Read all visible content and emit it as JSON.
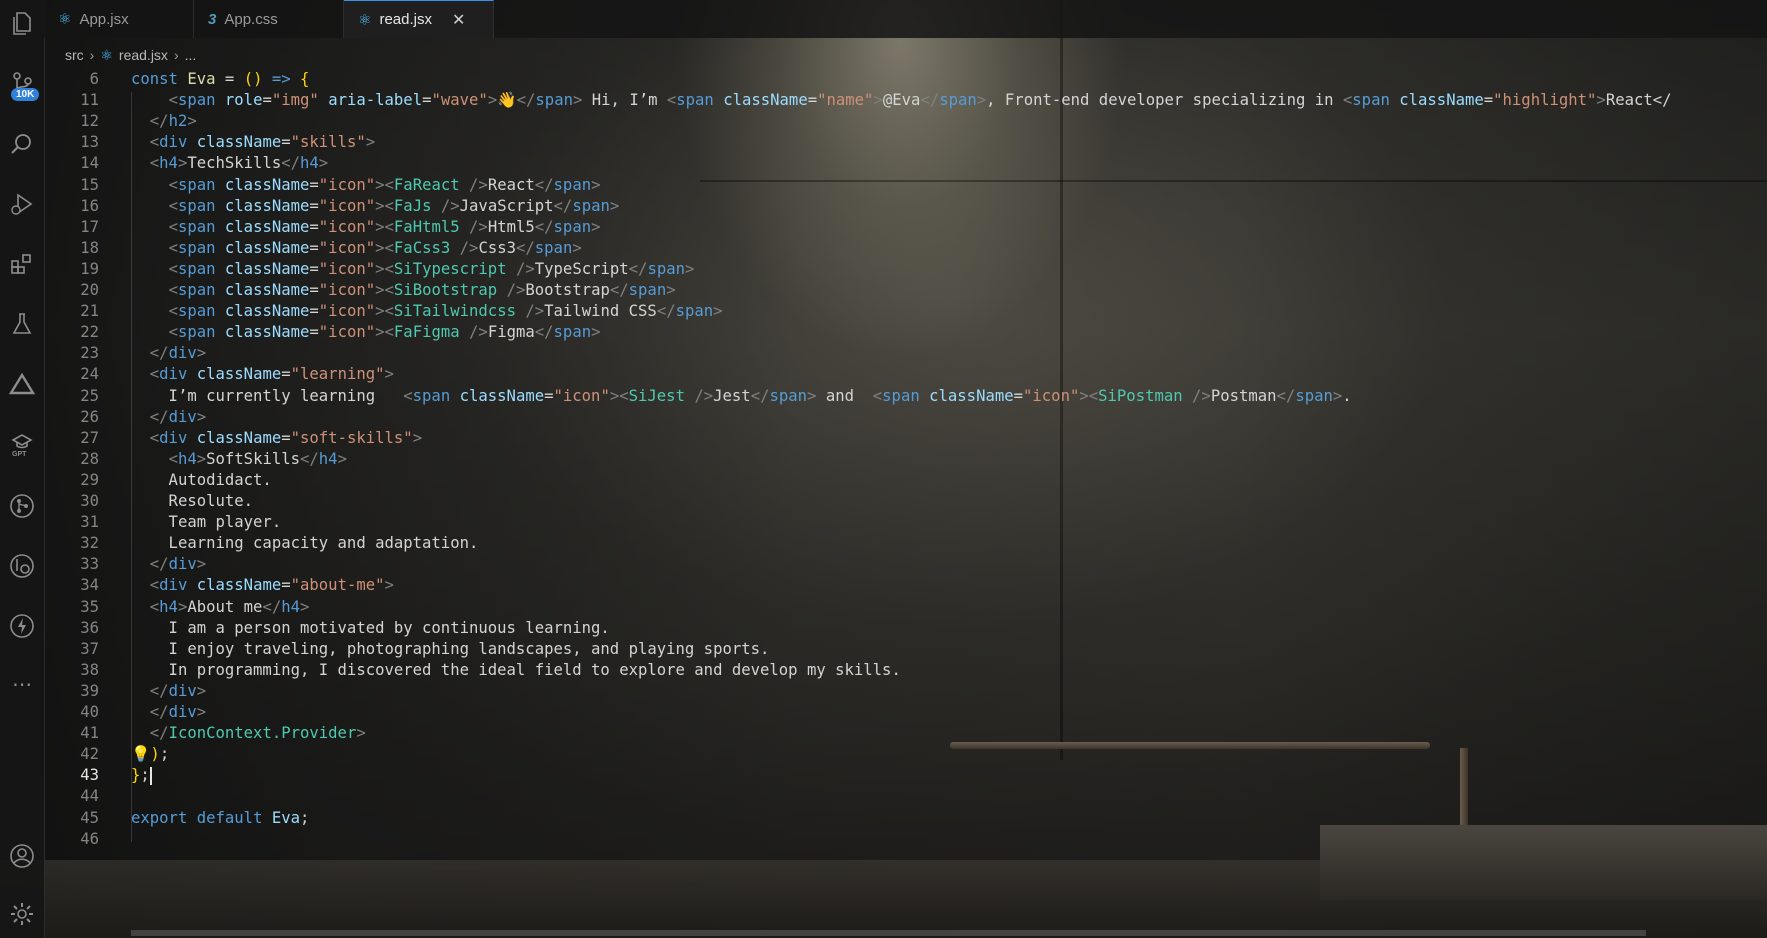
{
  "tabs": [
    {
      "label": "App.jsx",
      "icon": "react-icon",
      "active": false
    },
    {
      "label": "App.css",
      "icon": "css-icon",
      "active": false
    },
    {
      "label": "read.jsx",
      "icon": "react-icon",
      "active": true
    }
  ],
  "close_glyph": "✕",
  "breadcrumb": {
    "folder": "src",
    "file": "read.jsx",
    "more": "..."
  },
  "activity": {
    "items": [
      "explorer-icon",
      "source-control-icon",
      "search-icon",
      "run-debug-icon",
      "extensions-icon",
      "testing-icon",
      "deploy-icon",
      "gpt-icon",
      "git-graph-icon",
      "remote-icon",
      "lightning-icon",
      "more-icon",
      "account-icon",
      "settings-icon"
    ],
    "badge": "10K"
  },
  "editor": {
    "current_line": "43",
    "lines": [
      {
        "n": "6",
        "t": "const Eva = () => {"
      },
      {
        "n": "11",
        "t": "    <span role=\"img\" aria-label=\"wave\">👋</span> Hi, I’m <span className=\"name\">@Eva</span>, Front-end developer specializing in <span className=\"highlight\">React</"
      },
      {
        "n": "12",
        "t": "  </h2>"
      },
      {
        "n": "13",
        "t": "  <div className=\"skills\">"
      },
      {
        "n": "14",
        "t": "  <h4>TechSkills</h4>"
      },
      {
        "n": "15",
        "t": "    <span className=\"icon\"><FaReact />React</span>"
      },
      {
        "n": "16",
        "t": "    <span className=\"icon\"><FaJs />JavaScript</span>"
      },
      {
        "n": "17",
        "t": "    <span className=\"icon\"><FaHtml5 />Html5</span>"
      },
      {
        "n": "18",
        "t": "    <span className=\"icon\"><FaCss3 />Css3</span>"
      },
      {
        "n": "19",
        "t": "    <span className=\"icon\"><SiTypescript />TypeScript</span>"
      },
      {
        "n": "20",
        "t": "    <span className=\"icon\"><SiBootstrap />Bootstrap</span>"
      },
      {
        "n": "21",
        "t": "    <span className=\"icon\"><SiTailwindcss />Tailwind CSS</span>"
      },
      {
        "n": "22",
        "t": "    <span className=\"icon\"><FaFigma />Figma</span>"
      },
      {
        "n": "23",
        "t": "  </div>"
      },
      {
        "n": "24",
        "t": "  <div className=\"learning\">"
      },
      {
        "n": "25",
        "t": "    I’m currently learning   <span className=\"icon\"><SiJest />Jest</span> and  <span className=\"icon\"><SiPostman />Postman</span>."
      },
      {
        "n": "26",
        "t": "  </div>"
      },
      {
        "n": "27",
        "t": "  <div className=\"soft-skills\">"
      },
      {
        "n": "28",
        "t": "    <h4>SoftSkills</h4>"
      },
      {
        "n": "29",
        "t": "    Autodidact."
      },
      {
        "n": "30",
        "t": "    Resolute."
      },
      {
        "n": "31",
        "t": "    Team player."
      },
      {
        "n": "32",
        "t": "    Learning capacity and adaptation."
      },
      {
        "n": "33",
        "t": "  </div>"
      },
      {
        "n": "34",
        "t": "  <div className=\"about-me\">"
      },
      {
        "n": "35",
        "t": "  <h4>About me</h4>"
      },
      {
        "n": "36",
        "t": "    I am a person motivated by continuous learning."
      },
      {
        "n": "37",
        "t": "    I enjoy traveling, photographing landscapes, and playing sports."
      },
      {
        "n": "38",
        "t": "    In programming, I discovered the ideal field to explore and develop my skills."
      },
      {
        "n": "39",
        "t": "  </div>"
      },
      {
        "n": "40",
        "t": "  </div>"
      },
      {
        "n": "41",
        "t": "  </IconContext.Provider>"
      },
      {
        "n": "42",
        "t": "💡);"
      },
      {
        "n": "43",
        "t": "};"
      },
      {
        "n": "44",
        "t": ""
      },
      {
        "n": "45",
        "t": "export default Eva;"
      },
      {
        "n": "46",
        "t": ""
      }
    ]
  }
}
